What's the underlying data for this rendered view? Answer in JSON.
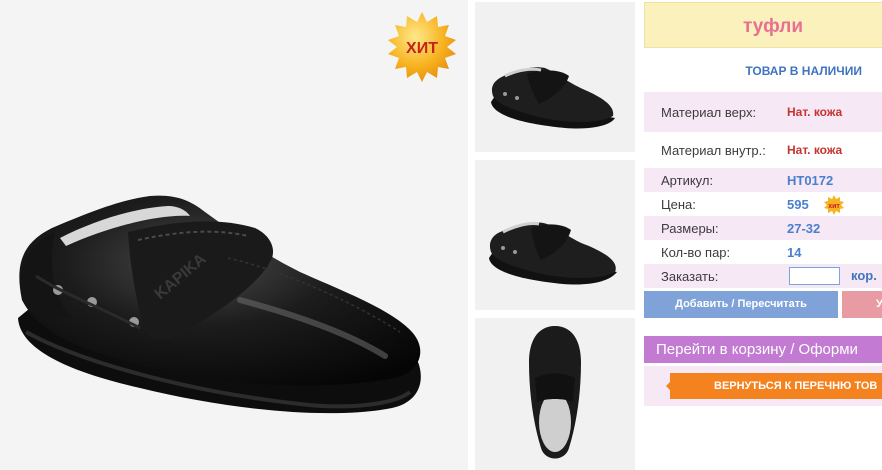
{
  "product": {
    "title": "туфли",
    "stock_status": "ТОВАР В НАЛИЧИИ",
    "hit_badge": "ХИТ",
    "hit_small": "хит",
    "brand_emboss": "KAPIKA"
  },
  "specs": {
    "material_top_label": "Материал верх:",
    "material_top_value": "Нат. кожа",
    "material_inner_label": "Материал внутр.:",
    "material_inner_value": "Нат. кожа",
    "article_label": "Артикул:",
    "article_value": "НТ0172",
    "price_label": "Цена:",
    "price_value": "595",
    "sizes_label": "Размеры:",
    "sizes_value": "27-32",
    "pairs_label": "Кол-во пар:",
    "pairs_value": "14",
    "order_label": "Заказать:",
    "order_value": "",
    "order_unit": "кор."
  },
  "actions": {
    "add_label": "Добавить / Пересчитать",
    "delete_label": "У",
    "cart_label": "Перейти в корзину / Оформи",
    "back_label": "ВЕРНУТЬСЯ К ПЕРЕЧНЮ ТОВ"
  },
  "colors": {
    "title_bg": "#fbf1bd",
    "title_text": "#e76f94",
    "row_pink": "#f7e8f6",
    "add_button": "#7fa3d8",
    "cart_bar": "#c27ad3",
    "back_button": "#f4821f"
  }
}
